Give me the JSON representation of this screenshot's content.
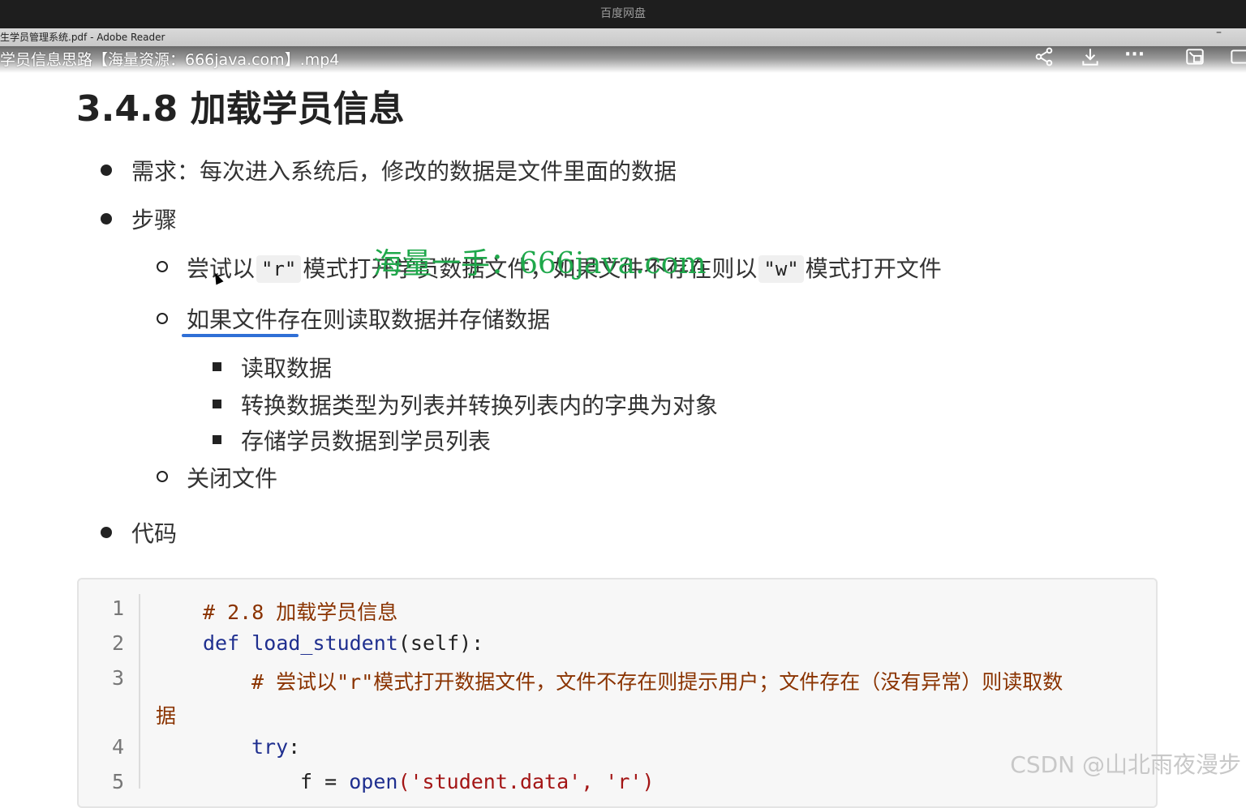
{
  "app_title": "百度网盘",
  "reader": {
    "title": "生学员管理系统.pdf - Adobe Reader",
    "minimize": "–"
  },
  "video": {
    "title": "学员信息思路【海量资源：666java.com】.mp4",
    "icons": [
      "share-icon",
      "download-icon",
      "more-icon",
      "picture-in-picture-icon",
      "fullscreen-icon"
    ],
    "more_label": "···"
  },
  "doc": {
    "heading": "3.4.8 加载学员信息",
    "bullets": [
      {
        "text": "需求：每次进入系统后，修改的数据是文件里面的数据"
      },
      {
        "text": "步骤"
      },
      {
        "text": "代码"
      }
    ],
    "steps": {
      "step1": {
        "pre": "尝试以",
        "code1": "\"r\"",
        "mid": "模式打开学员数据文件，如果文件不存在则以",
        "code2": "\"w\"",
        "post": "模式打开文件"
      },
      "step2": "如果文件存在则读取数据并存储数据",
      "substeps": [
        "读取数据",
        "转换数据类型为列表并转换列表内的字典为对象",
        "存储学员数据到学员列表"
      ],
      "step3": "关闭文件"
    },
    "watermark": "海量一手：666java.com"
  },
  "code": {
    "line_numbers": [
      "1",
      "2",
      "3",
      "4",
      "5"
    ],
    "line1": "# 2.8 加载学员信息",
    "line2_kw": "def",
    "line2_fn": "load_student",
    "line2_rest": "(self):",
    "line3a": "# 尝试以\"r\"模式打开数据文件，文件不存在则提示用户；文件存在（没有异常）则读取数",
    "line3b": "据",
    "line4_kw": "try",
    "line4_rest": ":",
    "line5_var": "f",
    "line5_eq": " = ",
    "line5_fn": "open",
    "line5_args": "('student.data', 'r')"
  },
  "footer_watermark": "CSDN @山北雨夜漫步",
  "colors": {
    "accent_underline": "#2f6fd6",
    "watermark": "#1fa84b",
    "comment": "#8a3300",
    "keyword": "#1f2f8f"
  }
}
